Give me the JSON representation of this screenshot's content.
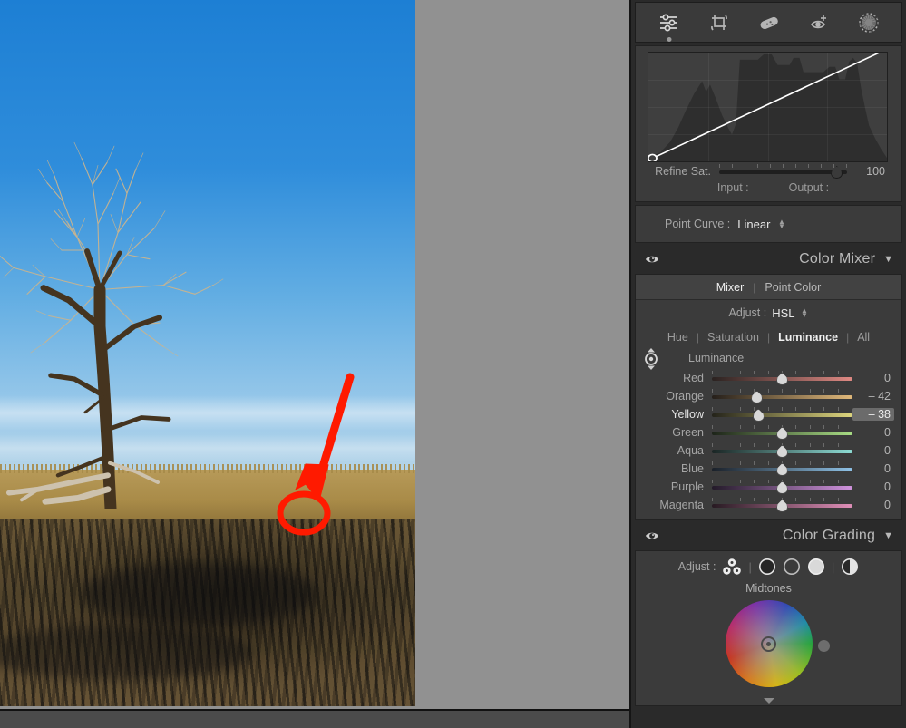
{
  "module_bar": {
    "tools": [
      {
        "name": "edit-sliders-icon",
        "label": "Edit",
        "selected": true
      },
      {
        "name": "crop-icon",
        "label": "Crop & Rotate",
        "selected": false
      },
      {
        "name": "healing-brush-icon",
        "label": "Healing Brush",
        "selected": false
      },
      {
        "name": "red-eye-icon",
        "label": "Red Eye",
        "selected": false
      },
      {
        "name": "masking-icon",
        "label": "Masking",
        "selected": false
      }
    ]
  },
  "tone_curve": {
    "refine_sat_label": "Refine Sat.",
    "refine_sat_value": "100",
    "refine_sat_percent": 92,
    "input_label": "Input :",
    "output_label": "Output :",
    "point_curve_label": "Point Curve :",
    "point_curve_value": "Linear",
    "curve_type": "linear"
  },
  "color_mixer": {
    "title": "Color Mixer",
    "disclosure": "▼",
    "tabs": [
      {
        "label": "Mixer",
        "active": true
      },
      {
        "label": "Point Color",
        "active": false
      }
    ],
    "adjust_label": "Adjust :",
    "adjust_value": "HSL",
    "sub_tabs": [
      {
        "label": "Hue",
        "active": false
      },
      {
        "label": "Saturation",
        "active": false
      },
      {
        "label": "Luminance",
        "active": true
      },
      {
        "label": "All",
        "active": false
      }
    ],
    "channel_caption": "Luminance",
    "sliders": [
      {
        "label": "Red",
        "value": "0",
        "percent": 50,
        "active": false,
        "boxed": false,
        "from": "#2a2220",
        "to": "#e08a84"
      },
      {
        "label": "Orange",
        "value": "– 42",
        "percent": 32,
        "active": false,
        "boxed": false,
        "from": "#251f1a",
        "to": "#e0b87a"
      },
      {
        "label": "Yellow",
        "value": "– 38",
        "percent": 33,
        "active": true,
        "boxed": true,
        "from": "#24231a",
        "to": "#ded67e"
      },
      {
        "label": "Green",
        "value": "0",
        "percent": 50,
        "active": false,
        "boxed": false,
        "from": "#1d2419",
        "to": "#a8dc84"
      },
      {
        "label": "Aqua",
        "value": "0",
        "percent": 50,
        "active": false,
        "boxed": false,
        "from": "#1a2524",
        "to": "#8ddcd4"
      },
      {
        "label": "Blue",
        "value": "0",
        "percent": 50,
        "active": false,
        "boxed": false,
        "from": "#1a2029",
        "to": "#8fc2e6"
      },
      {
        "label": "Purple",
        "value": "0",
        "percent": 50,
        "active": false,
        "boxed": false,
        "from": "#231a29",
        "to": "#d093dd"
      },
      {
        "label": "Magenta",
        "value": "0",
        "percent": 50,
        "active": false,
        "boxed": false,
        "from": "#271a22",
        "to": "#e08fb8"
      }
    ]
  },
  "color_grading": {
    "title": "Color Grading",
    "disclosure": "▼",
    "adjust_label": "Adjust :",
    "modes": [
      {
        "name": "all-wheels-icon",
        "selected": false
      },
      {
        "name": "shadows-icon",
        "selected": false
      },
      {
        "name": "midtones-icon",
        "selected": false
      },
      {
        "name": "highlights-icon",
        "selected": true
      },
      {
        "name": "blending-balance-icon",
        "selected": false
      }
    ],
    "active_range_label": "Midtones"
  },
  "annotation": {
    "shape": "red-arrow-with-circle",
    "color": "#FF1A00"
  },
  "colors": {
    "panel_bg": "#2a2a2a",
    "block_bg": "#3b3b3b",
    "canvas_bg": "#919191",
    "accent_red": "#FF1A00"
  }
}
